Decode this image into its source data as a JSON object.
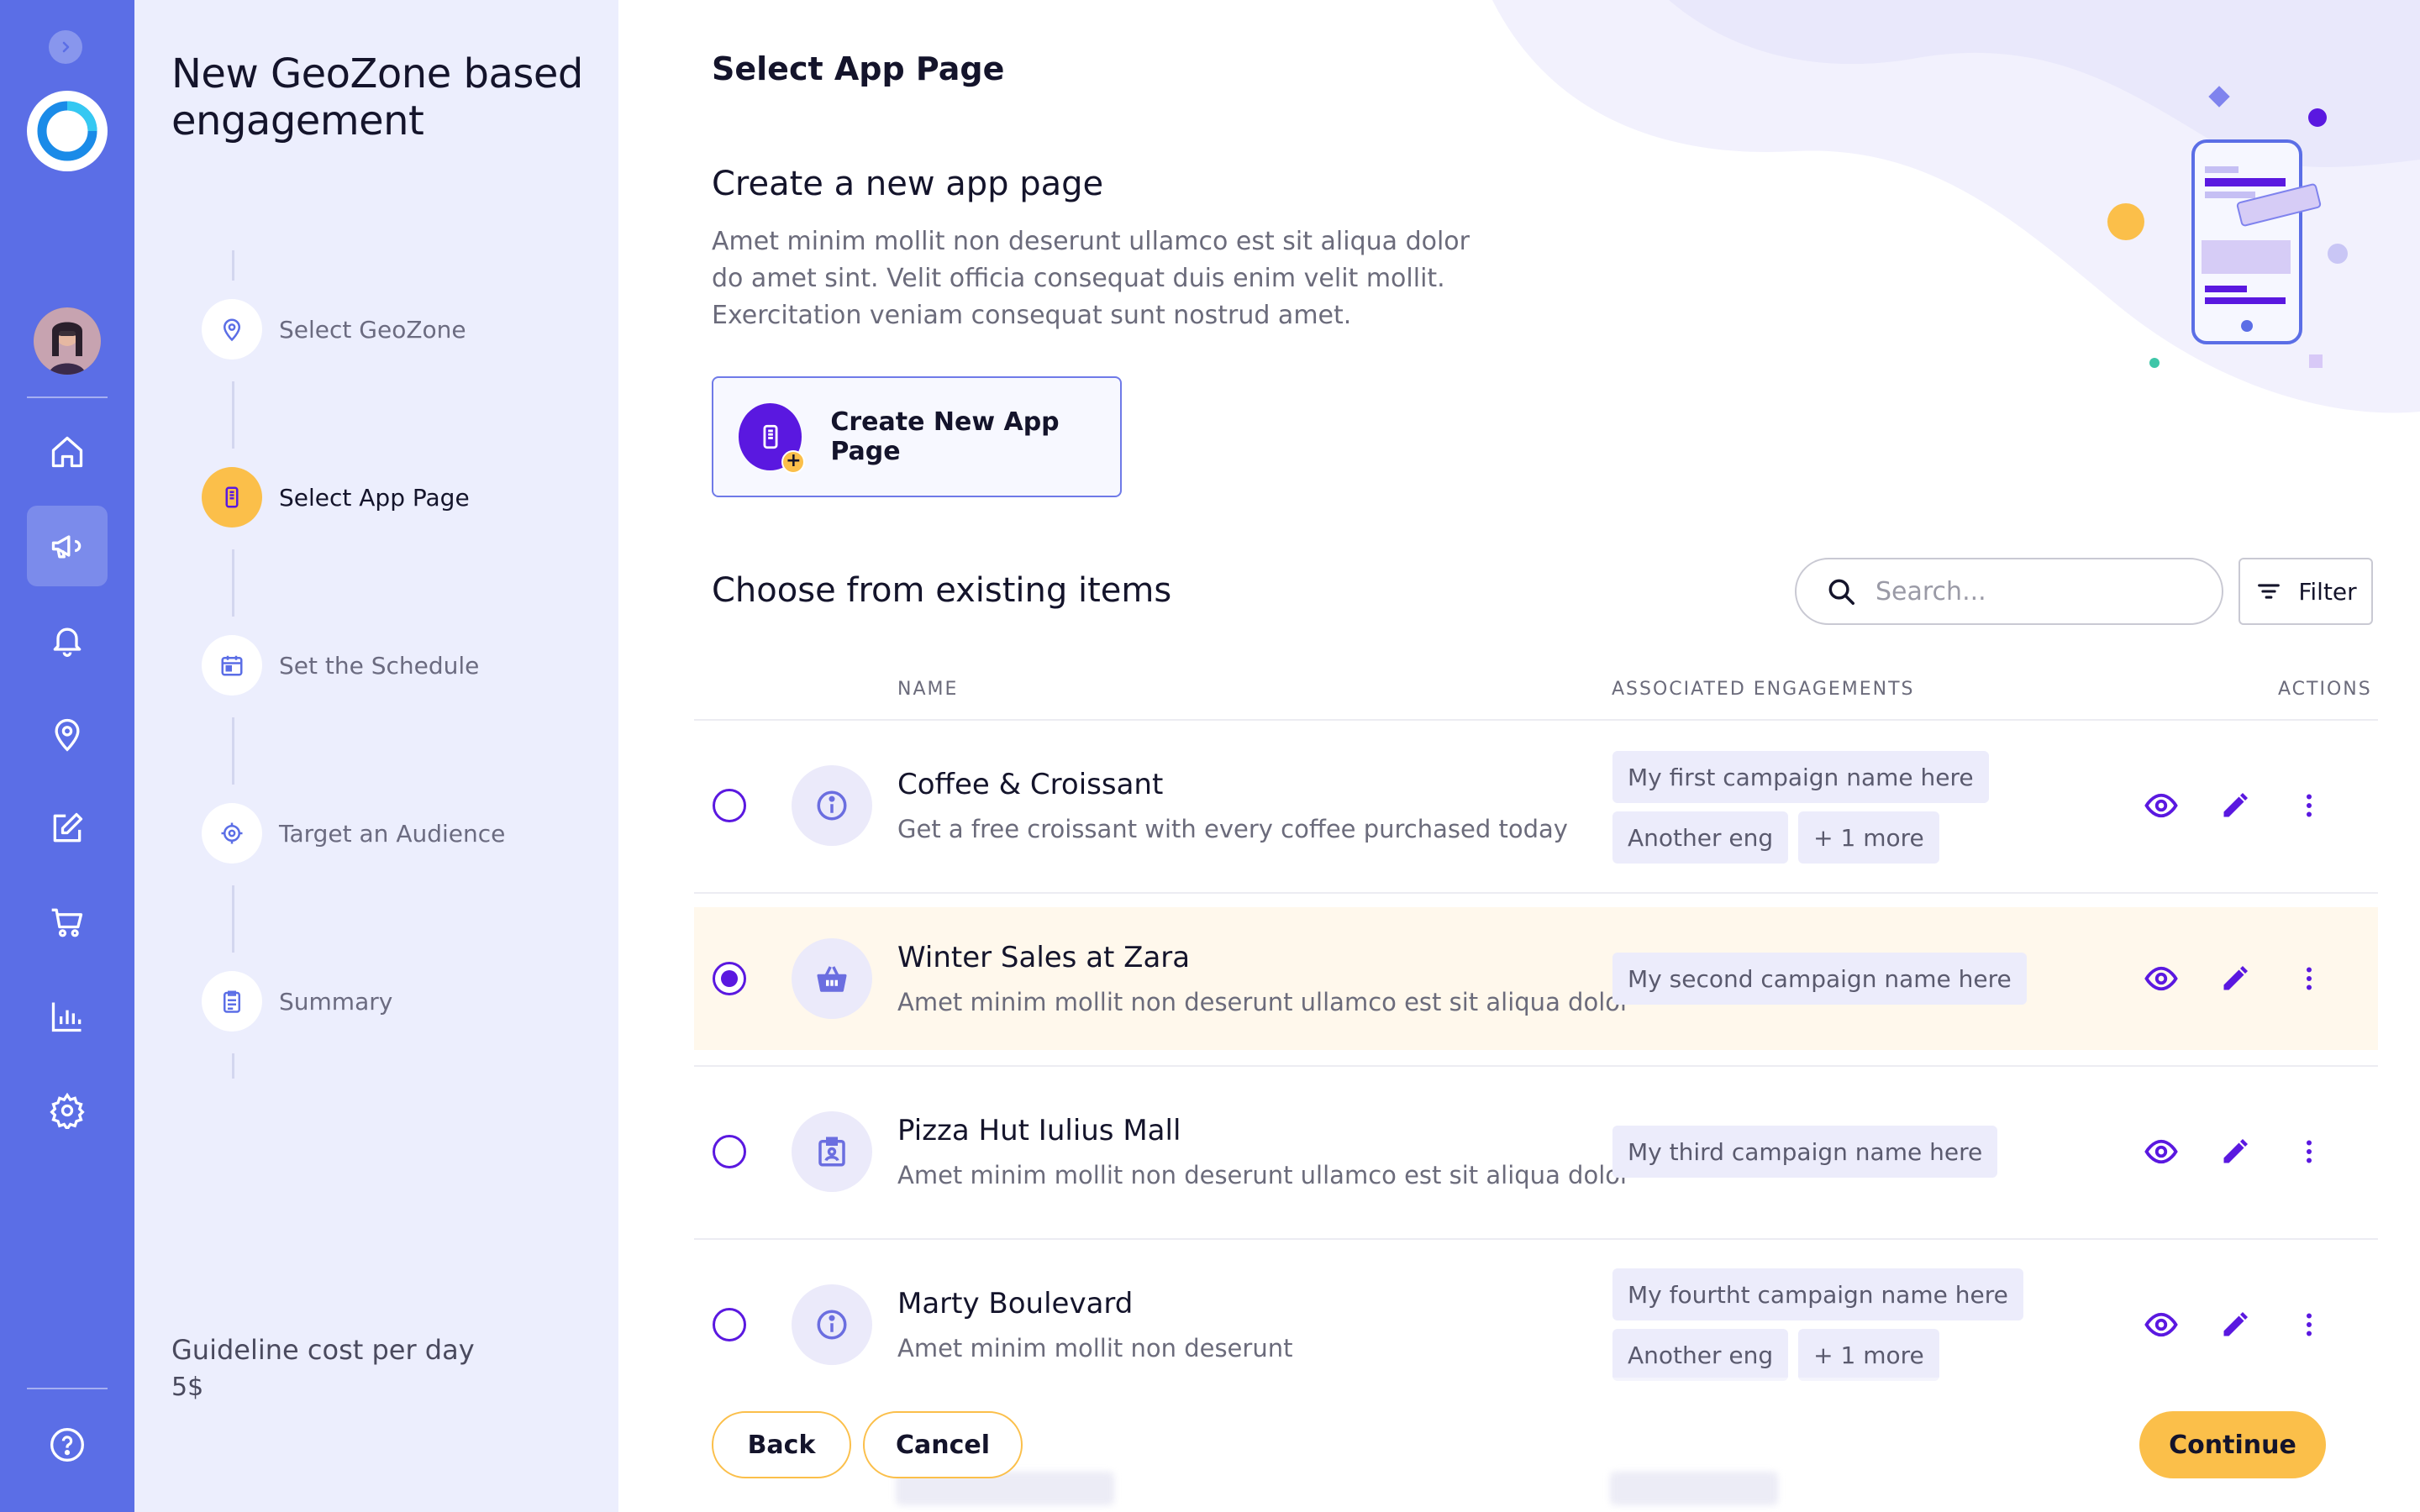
{
  "rail": {
    "nav": [
      "home-icon",
      "megaphone-icon",
      "bell-icon",
      "location-pin-icon",
      "edit-icon",
      "cart-icon",
      "chart-icon",
      "gear-icon"
    ],
    "active_index": 1,
    "help": "help-icon",
    "accent": "#5b6ee6"
  },
  "sidebar": {
    "title": "New GeoZone based engagement",
    "steps": [
      {
        "label": "Select GeoZone",
        "icon": "map-pin-icon"
      },
      {
        "label": "Select App Page",
        "icon": "phone-icon"
      },
      {
        "label": "Set the Schedule",
        "icon": "calendar-icon"
      },
      {
        "label": "Target an Audience",
        "icon": "target-icon"
      },
      {
        "label": "Summary",
        "icon": "clipboard-icon"
      }
    ],
    "active_step": 1,
    "cost_label": "Guideline cost per day",
    "cost_value": "5$"
  },
  "main": {
    "page_title": "Select App Page",
    "create_heading": "Create a new app page",
    "create_description": "Amet minim mollit non deserunt ullamco est sit aliqua dolor do amet sint. Velit officia consequat duis enim velit mollit. Exercitation veniam consequat sunt nostrud amet.",
    "create_button": "Create New App Page",
    "existing_heading": "Choose from existing items",
    "search_placeholder": "Search...",
    "filter_label": "Filter",
    "columns": {
      "name": "NAME",
      "engagements": "ASSOCIATED ENGAGEMENTS",
      "actions": "ACTIONS"
    },
    "rows": [
      {
        "name": "Coffee & Croissant",
        "description": "Get a free croissant with every coffee purchased today",
        "icon": "info-icon",
        "selected": false,
        "chips": [
          "My first campaign name here",
          "Another eng",
          "+ 1 more"
        ]
      },
      {
        "name": "Winter Sales at Zara",
        "description": "Amet minim mollit non deserunt ullamco est sit aliqua dolor",
        "icon": "basket-icon",
        "selected": true,
        "chips": [
          "My second campaign name here"
        ]
      },
      {
        "name": "Pizza Hut Iulius Mall",
        "description": "Amet minim mollit non deserunt ullamco est sit aliqua dolor",
        "icon": "badge-icon",
        "selected": false,
        "chips": [
          "My third campaign name here"
        ]
      },
      {
        "name": "Marty Boulevard",
        "description": "Amet minim mollit non deserunt",
        "icon": "info-icon",
        "selected": false,
        "chips": [
          "My fourtht campaign name here",
          "Another eng",
          "+ 1 more"
        ]
      }
    ],
    "row_actions": [
      "view-icon",
      "edit-icon",
      "more-icon"
    ]
  },
  "footer": {
    "back": "Back",
    "cancel": "Cancel",
    "continue": "Continue"
  }
}
